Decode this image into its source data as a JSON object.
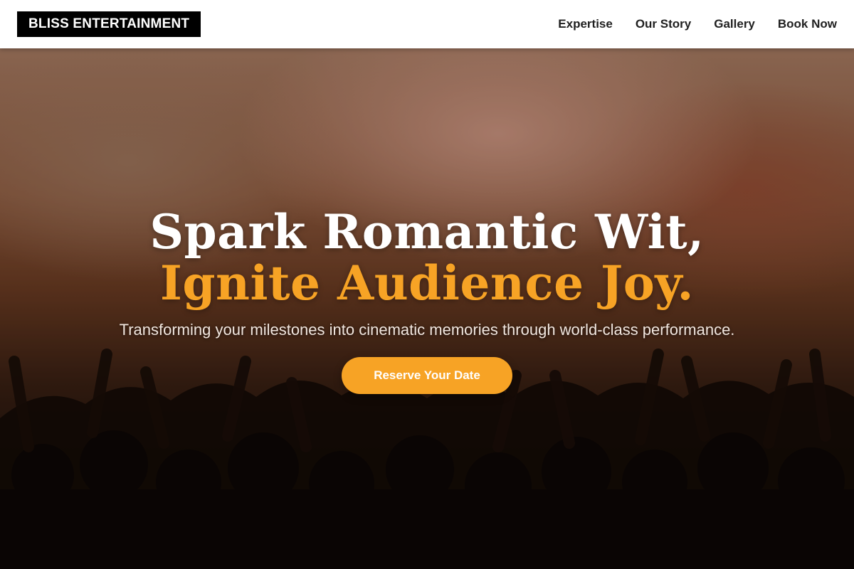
{
  "brand": {
    "logo_text": "BLISS ENTERTAINMENT"
  },
  "nav": {
    "items": [
      {
        "label": "Expertise"
      },
      {
        "label": "Our Story"
      },
      {
        "label": "Gallery"
      },
      {
        "label": "Book Now"
      }
    ]
  },
  "hero": {
    "headline_line1": "Spark Romantic Wit,",
    "headline_line2": "Ignite Audience Joy.",
    "subtext": "Transforming your milestones into cinematic memories through world-class performance.",
    "cta_label": "Reserve Your Date",
    "background_description": "concert-crowd-image"
  },
  "colors": {
    "accent": "#f7a325",
    "navbar_bg": "#ffffff",
    "logo_bg": "#000000",
    "nav_text": "#1f1f1f"
  }
}
